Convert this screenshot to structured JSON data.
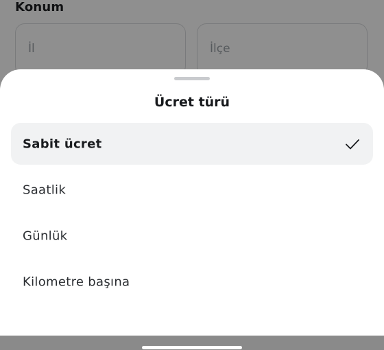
{
  "background": {
    "section_label": "Konum",
    "province_placeholder": "İl",
    "district_placeholder": "İlçe"
  },
  "sheet": {
    "title": "Ücret türü",
    "options": [
      {
        "label": "Sabit ücret",
        "selected": true
      },
      {
        "label": "Saatlik",
        "selected": false
      },
      {
        "label": "Günlük",
        "selected": false
      },
      {
        "label": "Kilometre başına",
        "selected": false
      }
    ]
  },
  "icons": {
    "selected_indicator": "checkmark-icon"
  },
  "colors": {
    "selected_row_bg": "#f1f2f3",
    "overlay": "rgba(0,0,0,0.44)",
    "text_primary": "#17191c"
  }
}
